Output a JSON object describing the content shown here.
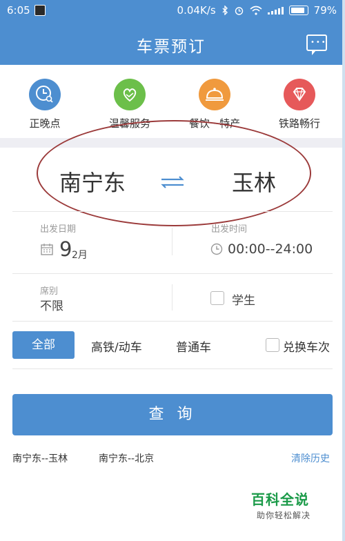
{
  "status_bar": {
    "time": "6:05",
    "network_speed": "0.04K/s",
    "battery": "79%"
  },
  "header": {
    "title": "车票预订",
    "message_icon": "message-icon"
  },
  "quick_actions": [
    {
      "label": "正晚点",
      "icon": "clock-search-icon",
      "color": "#4d8ed0"
    },
    {
      "label": "温馨服务",
      "icon": "heart-hands-icon",
      "color": "#6cbf4a"
    },
    {
      "label": "餐饮 · 特产",
      "icon": "cloche-icon",
      "color": "#f09a3e"
    },
    {
      "label": "铁路畅行",
      "icon": "diamond-icon",
      "color": "#e6595a"
    }
  ],
  "route": {
    "from": "南宁东",
    "to": "玉林",
    "swap_icon": "swap-arrows-icon"
  },
  "date": {
    "label": "出发日期",
    "day": "9",
    "month": "2月"
  },
  "time": {
    "label": "出发时间",
    "value": "00:00--24:00"
  },
  "seat": {
    "label": "席别",
    "value": "不限"
  },
  "student": {
    "label": "学生"
  },
  "train_types": {
    "all": "全部",
    "high_speed": "高铁/动车",
    "normal": "普通车",
    "exchange": "兑换车次"
  },
  "query_button": "查 询",
  "history": {
    "items": [
      "南宁东--玉林",
      "南宁东--北京"
    ],
    "clear": "清除历史"
  },
  "watermark": {
    "title": "百科全说",
    "subtitle": "助你轻松解决"
  },
  "colors": {
    "primary": "#4d8ed0",
    "annotation": "#9b3a3a"
  }
}
